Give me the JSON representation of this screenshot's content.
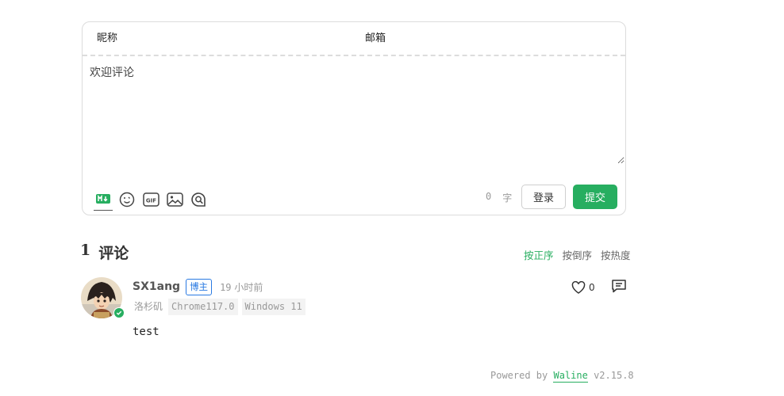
{
  "form": {
    "nick_placeholder": "昵称",
    "mail_placeholder": "邮箱",
    "editor_placeholder": "欢迎评论",
    "toolbar_icons": [
      "markdown-icon",
      "emoji-icon",
      "gif-icon",
      "image-icon",
      "preview-icon"
    ],
    "word_count": "0",
    "word_unit": "字",
    "login_label": "登录",
    "submit_label": "提交"
  },
  "comments": {
    "count": "1",
    "count_label": "评论",
    "sort_options": [
      "按正序",
      "按倒序",
      "按热度"
    ],
    "sort_active": "按正序",
    "items": [
      {
        "nick": "SX1ang",
        "badge": "博主",
        "time_num": "19",
        "time_unit": "小时前",
        "location": "洛杉矶",
        "browser": "Chrome117.0",
        "os": "Windows 11",
        "content": "test",
        "likes": "0"
      }
    ]
  },
  "footer": {
    "powered_by": "Powered by",
    "brand": "Waline",
    "version": "v2.15.8"
  },
  "colors": {
    "accent": "#27ae60",
    "badge": "#2a7ae2",
    "muted": "#999999"
  }
}
